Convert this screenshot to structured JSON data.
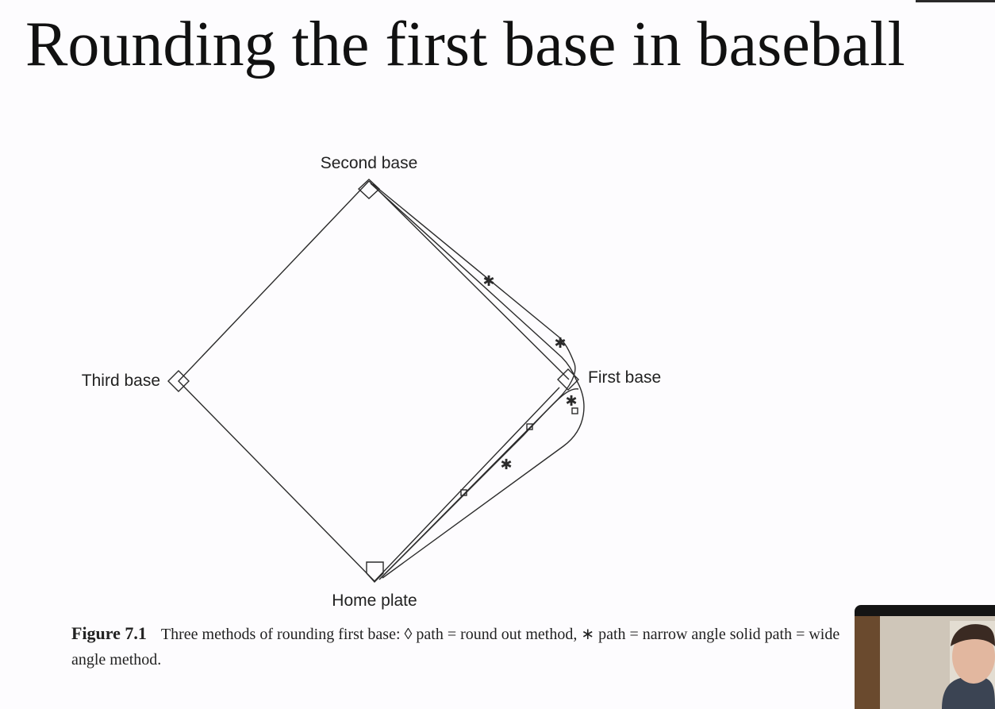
{
  "slide": {
    "title": "Rounding the first base in baseball"
  },
  "diagram": {
    "labels": {
      "second_base": "Second base",
      "third_base": "Third base",
      "first_base": "First base",
      "home_plate": "Home plate"
    },
    "paths": [
      {
        "marker": "diamond-small-square",
        "method": "round out method"
      },
      {
        "marker": "asterisk",
        "method": "narrow angle"
      },
      {
        "marker": "none (solid)",
        "method": "wide angle method"
      }
    ]
  },
  "caption": {
    "label": "Figure 7.1",
    "text": "Three methods of rounding first base: ◊ path = round out method, ∗ path = narrow angle solid path = wide angle method."
  },
  "webcam": {
    "description_icon": "webcam-person-icon"
  },
  "colors": {
    "background": "#fdfcfe",
    "ink": "#222222"
  }
}
